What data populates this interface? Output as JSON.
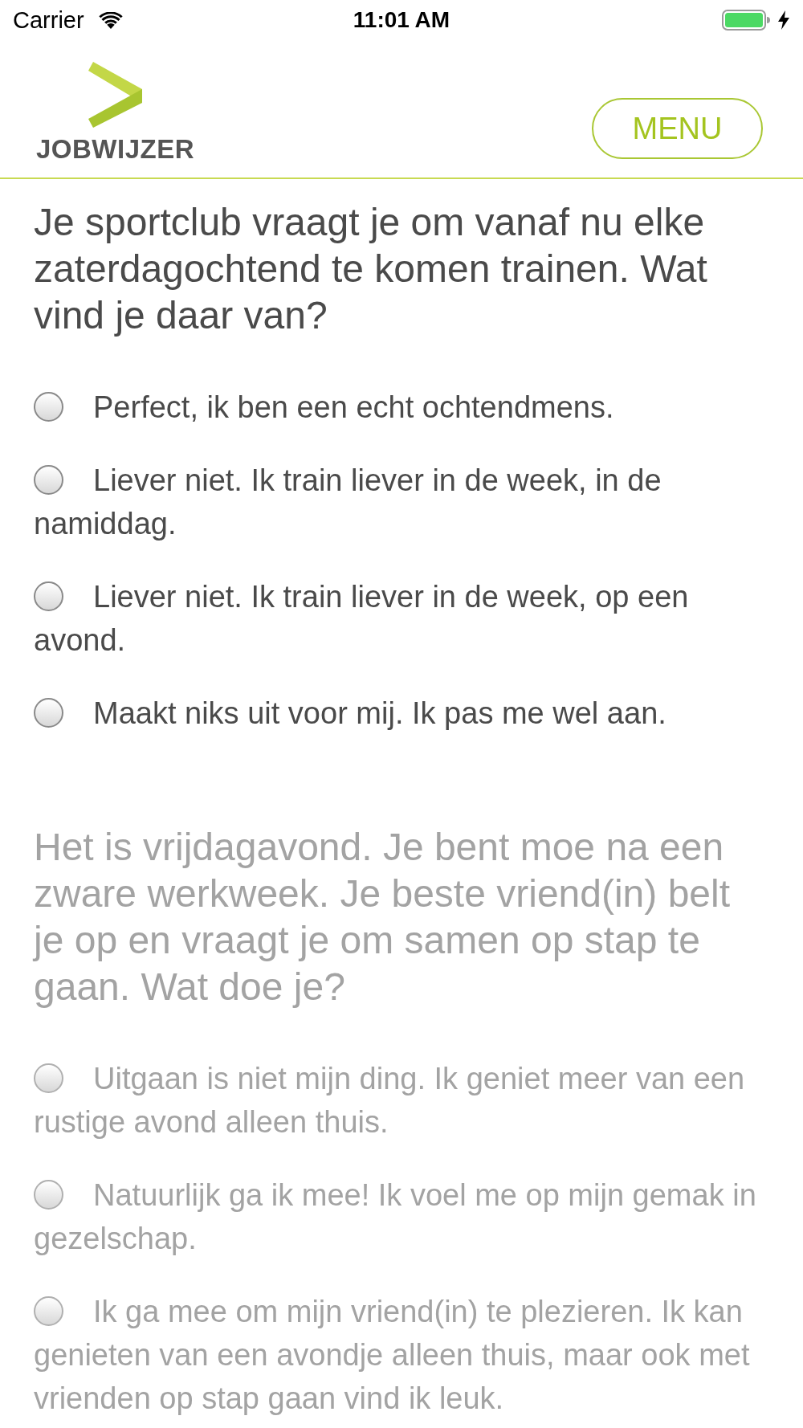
{
  "status_bar": {
    "carrier": "Carrier",
    "time": "11:01 AM"
  },
  "header": {
    "logo_text": "JOBWIJZER",
    "menu_button": "MENU"
  },
  "questions": [
    {
      "text": "Je sportclub vraagt je om vanaf nu elke zaterdagochtend te komen trainen. Wat vind je daar van?",
      "disabled": false,
      "options": [
        {
          "label": "Perfect, ik ben een echt ochtendmens.",
          "selected": false
        },
        {
          "label": "Liever niet. Ik train liever in de week, in de namiddag.",
          "selected": false
        },
        {
          "label": "Liever niet. Ik train liever in de week, op een avond.",
          "selected": false
        },
        {
          "label": "Maakt niks uit voor mij. Ik pas me wel aan.",
          "selected": false
        }
      ]
    },
    {
      "text": "Het is vrijdagavond. Je bent moe na een zware werkweek. Je beste vriend(in) belt je op en vraagt je om samen op stap te gaan. Wat doe je?",
      "disabled": true,
      "options": [
        {
          "label": "Uitgaan is niet mijn ding. Ik geniet meer van een rustige avond alleen thuis.",
          "selected": false
        },
        {
          "label": "Natuurlijk ga ik mee! Ik voel me op mijn gemak in gezelschap.",
          "selected": false
        },
        {
          "label": "Ik ga mee om mijn vriend(in) te plezieren. Ik kan genieten van een avondje alleen thuis, maar ook met vrienden op stap gaan vind ik leuk.",
          "selected": false
        }
      ]
    }
  ]
}
